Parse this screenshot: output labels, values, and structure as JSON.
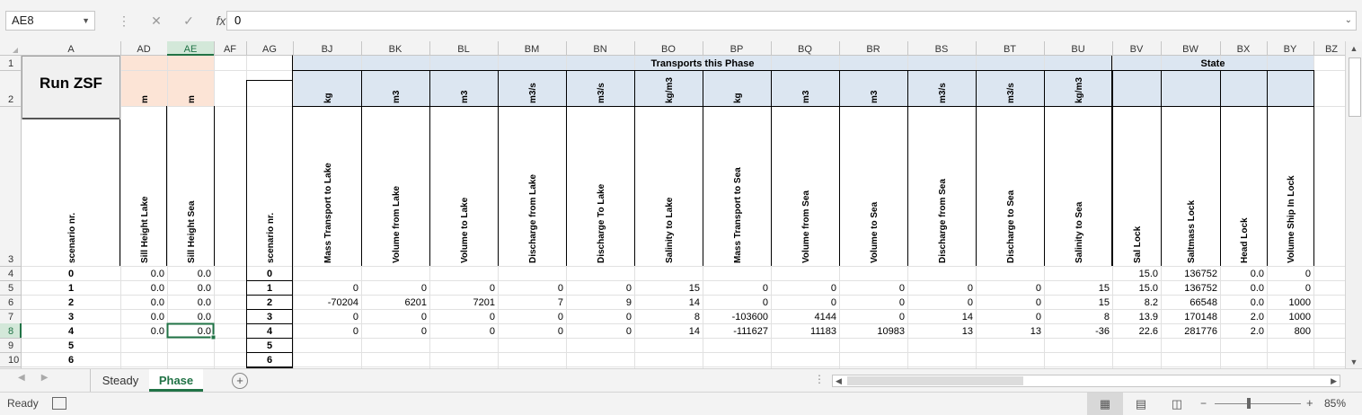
{
  "formula_bar": {
    "name_box": "AE8",
    "cancel_glyph": "✕",
    "enter_glyph": "✓",
    "function_glyph": "fx",
    "value": "0"
  },
  "button": {
    "label": "Run ZSF"
  },
  "columns": [
    "A",
    "AD",
    "AE",
    "AF",
    "AG",
    "BJ",
    "BK",
    "BL",
    "BM",
    "BN",
    "BO",
    "BP",
    "BQ",
    "BR",
    "BS",
    "BT",
    "BU",
    "BV",
    "BW",
    "BX",
    "BY",
    "BZ"
  ],
  "row_numbers": [
    "1",
    "2",
    "3",
    "4",
    "5",
    "6",
    "7",
    "8",
    "9",
    "10"
  ],
  "group_headers": {
    "transports": "Transports this Phase",
    "state": "State"
  },
  "units": {
    "AD": "m",
    "AE": "m",
    "BJ": "kg",
    "BK": "m3",
    "BL": "m3",
    "BM": "m3/s",
    "BN": "m3/s",
    "BO": "kg/m3",
    "BP": "kg",
    "BQ": "m3",
    "BR": "m3",
    "BS": "m3/s",
    "BT": "m3/s",
    "BU": "kg/m3"
  },
  "headers": {
    "A": "scenario nr.",
    "AD": "Sill Height Lake",
    "AE": "Sill Height Sea",
    "AG": "scenario nr.",
    "BJ": "Mass Transport to Lake",
    "BK": "Volume from Lake",
    "BL": "Volume to Lake",
    "BM": "Discharge from Lake",
    "BN": "Discharge To Lake",
    "BO": "Salinity to Lake",
    "BP": "Mass Transport to Sea",
    "BQ": "Volume from Sea",
    "BR": "Volume to Sea",
    "BS": "Discharge from Sea",
    "BT": "Discharge to Sea",
    "BU": "Salinity to Sea",
    "BV": "Sal Lock",
    "BW": "Saltmass Lock",
    "BX": "Head Lock",
    "BY": "Volume Ship In Lock"
  },
  "rows": [
    {
      "A": "0",
      "AD": "0.0",
      "AE": "0.0",
      "AG": "0",
      "BJ": "",
      "BK": "",
      "BL": "",
      "BM": "",
      "BN": "",
      "BO": "",
      "BP": "",
      "BQ": "",
      "BR": "",
      "BS": "",
      "BT": "",
      "BU": "",
      "BV": "15.0",
      "BW": "136752",
      "BX": "0.0",
      "BY": "0"
    },
    {
      "A": "1",
      "AD": "0.0",
      "AE": "0.0",
      "AG": "1",
      "BJ": "0",
      "BK": "0",
      "BL": "0",
      "BM": "0",
      "BN": "0",
      "BO": "15",
      "BP": "0",
      "BQ": "0",
      "BR": "0",
      "BS": "0",
      "BT": "0",
      "BU": "15",
      "BV": "15.0",
      "BW": "136752",
      "BX": "0.0",
      "BY": "0"
    },
    {
      "A": "2",
      "AD": "0.0",
      "AE": "0.0",
      "AG": "2",
      "BJ": "-70204",
      "BK": "6201",
      "BL": "7201",
      "BM": "7",
      "BN": "9",
      "BO": "14",
      "BP": "0",
      "BQ": "0",
      "BR": "0",
      "BS": "0",
      "BT": "0",
      "BU": "15",
      "BV": "8.2",
      "BW": "66548",
      "BX": "0.0",
      "BY": "1000"
    },
    {
      "A": "3",
      "AD": "0.0",
      "AE": "0.0",
      "AG": "3",
      "BJ": "0",
      "BK": "0",
      "BL": "0",
      "BM": "0",
      "BN": "0",
      "BO": "8",
      "BP": "-103600",
      "BQ": "4144",
      "BR": "0",
      "BS": "14",
      "BT": "0",
      "BU": "8",
      "BV": "13.9",
      "BW": "170148",
      "BX": "2.0",
      "BY": "1000"
    },
    {
      "A": "4",
      "AD": "0.0",
      "AE": "0.0",
      "AG": "4",
      "BJ": "0",
      "BK": "0",
      "BL": "0",
      "BM": "0",
      "BN": "0",
      "BO": "14",
      "BP": "-111627",
      "BQ": "11183",
      "BR": "10983",
      "BS": "13",
      "BT": "13",
      "BU": "-36",
      "BV": "22.6",
      "BW": "281776",
      "BX": "2.0",
      "BY": "800"
    },
    {
      "A": "5",
      "AD": "",
      "AE": "",
      "AG": "5",
      "BJ": "",
      "BK": "",
      "BL": "",
      "BM": "",
      "BN": "",
      "BO": "",
      "BP": "",
      "BQ": "",
      "BR": "",
      "BS": "",
      "BT": "",
      "BU": "",
      "BV": "",
      "BW": "",
      "BX": "",
      "BY": ""
    },
    {
      "A": "6",
      "AD": "",
      "AE": "",
      "AG": "6",
      "BJ": "",
      "BK": "",
      "BL": "",
      "BM": "",
      "BN": "",
      "BO": "",
      "BP": "",
      "BQ": "",
      "BR": "",
      "BS": "",
      "BT": "",
      "BU": "",
      "BV": "",
      "BW": "",
      "BX": "",
      "BY": ""
    }
  ],
  "tabs": [
    {
      "label": "Steady",
      "active": false
    },
    {
      "label": "Phase",
      "active": true
    }
  ],
  "status": {
    "ready": "Ready",
    "zoom": "85%"
  },
  "colors": {
    "unit_fill_ad_ae": "#fce4d6",
    "unit_fill_transports": "#dce6f1",
    "group_header_fill": "#dce6f1",
    "active_tab": "#217346",
    "selection": "#217346"
  },
  "icons": {
    "name_box_dropdown": "chevron-down-icon",
    "cancel": "close-icon",
    "enter": "check-icon",
    "function": "function-icon",
    "add_sheet": "plus-icon",
    "macro": "macro-record-icon"
  }
}
